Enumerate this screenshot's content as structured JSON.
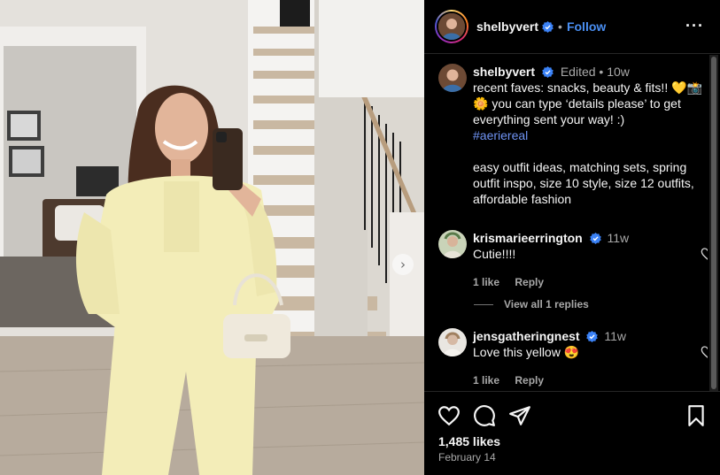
{
  "colors": {
    "accent": "#4a8ff3",
    "hashtag": "#6f93f3",
    "verified": "#3b82f6",
    "muted": "#a8a8a8"
  },
  "post": {
    "author": "shelbyvert",
    "follow_label": "Follow",
    "more_icon": "more-options-icon",
    "caption": {
      "username": "shelbyvert",
      "edited": "Edited",
      "time": "10w",
      "line1": "recent faves: snacks, beauty & fits!! 💛📸🌼 you can type ‘details please’ to get everything sent your way! :)",
      "hashtag": "#aeriereal",
      "line2": "easy outfit ideas, matching sets, spring outfit inspo, size 10 style, size 12 outfits, affordable fashion"
    },
    "comments": [
      {
        "username": "krismarieerrington",
        "time": "11w",
        "text": "Cutie!!!!",
        "likes": "1 like",
        "reply": "Reply"
      },
      {
        "username": "jensgatheringnest",
        "time": "11w",
        "text": "Love this yellow 😍",
        "likes": "1 like",
        "reply": "Reply"
      }
    ],
    "view_replies": "View all 1 replies",
    "likes_count": "1,485 likes",
    "date": "February 14",
    "carousel_next_icon": "chevron-right-icon"
  }
}
